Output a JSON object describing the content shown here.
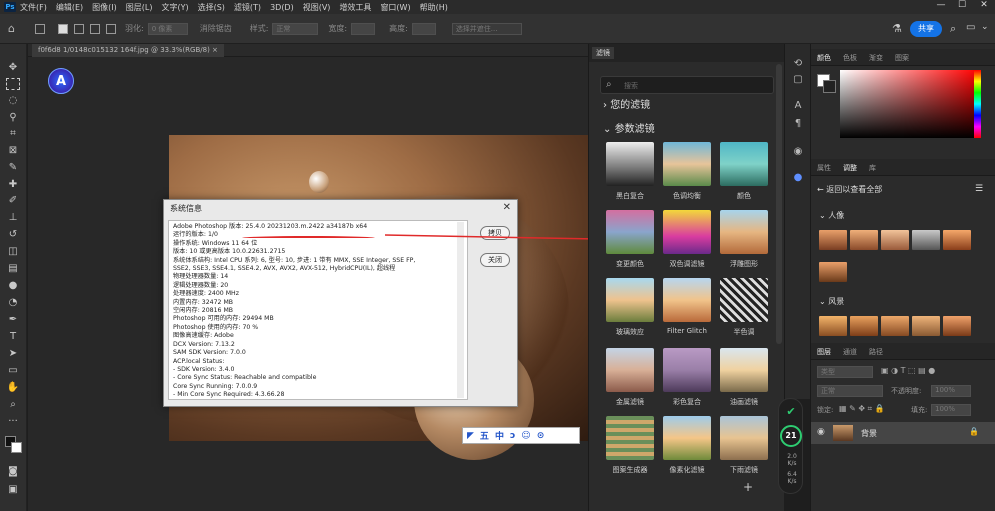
{
  "menubar": {
    "logo": "Ps",
    "items": [
      "文件(F)",
      "编辑(E)",
      "图像(I)",
      "图层(L)",
      "文字(Y)",
      "选择(S)",
      "滤镜(T)",
      "3D(D)",
      "视图(V)",
      "增效工具",
      "窗口(W)",
      "帮助(H)"
    ],
    "win_min": "—",
    "win_max": "☐",
    "win_close": "✕"
  },
  "optbar": {
    "feather_label": "羽化:",
    "feather_value": "0 像素",
    "antialias_label": "消除锯齿",
    "style_label": "样式:",
    "style_value": "正常",
    "width_label": "宽度:",
    "height_label": "高度:",
    "select_mask_label": "选择并遮住...",
    "share_label": "共享"
  },
  "doctab": {
    "label": "f0f6d8 1/0148c015132 164f.jpg @ 33.3%(RGB/8)  ×"
  },
  "app_logo": "A",
  "about": {
    "title": "系统信息",
    "close": "✕",
    "copy_label": "拷贝",
    "close_label": "关闭",
    "lines": [
      "Adobe Photoshop 版本: 25.4.0 20231203.m.2422 a34187b  x64",
      "运行的版本: 1/0",
      "操作系统: Windows 11 64 位",
      "版本: 10 或更高版本 10.0.22631.2715",
      "系统体系结构: Intel CPU 系列: 6, 型号: 10, 步进: 1 带有 MMX, SSE Integer, SSE FP,",
      "SSE2, SSE3, SSE4.1, SSE4.2, AVX, AVX2, AVX-512, HybridCPU(IL), 超线程",
      "物理处理器数量: 14",
      "逻辑处理器数量: 20",
      "处理器速度: 2400 MHz",
      "内置内存: 32472 MB",
      "空闲内存: 20816 MB",
      "Photoshop 可用的内存: 29494 MB",
      "Photoshop 使用的内存: 70 %",
      "图像高速缓存: Adobe",
      "DCX Version: 7.13.2",
      "SAM SDK Version: 7.0.0",
      "ACP.local Status:",
      " - SDK Version: 3.4.0",
      " - Core Sync Status: Reachable and compatible",
      "   Core Sync Running: 7.0.0.9",
      " - Min Core Sync Required: 4.3.66.28"
    ]
  },
  "ime": {
    "items": [
      "五",
      "中",
      "ↄ",
      "☺",
      "⊙"
    ]
  },
  "neural_filters": {
    "tab_label": "滤镜",
    "search_placeholder": "搜索",
    "section_mine": "您的滤镜",
    "section_param": "参数滤镜",
    "filters": [
      {
        "label": "黑白复合"
      },
      {
        "label": "色调均衡"
      },
      {
        "label": "颜色"
      },
      {
        "label": "变更颜色"
      },
      {
        "label": "双色调滤镜"
      },
      {
        "label": "浮雕图形"
      },
      {
        "label": "玻璃效应"
      },
      {
        "label": "Filter Glitch"
      },
      {
        "label": "半色调"
      },
      {
        "label": "金属滤镜"
      },
      {
        "label": "彩色复合"
      },
      {
        "label": "油画滤镜"
      },
      {
        "label": "图案生成器"
      },
      {
        "label": "像素化滤镜"
      },
      {
        "label": "下雨滤镜"
      }
    ],
    "add_label": "+"
  },
  "network_widget": {
    "shield": "✔",
    "value": "21",
    "up": "2.0",
    "up_unit": "K/s",
    "down": "6.4",
    "down_unit": "K/s"
  },
  "right": {
    "color_tabs": [
      "颜色",
      "色板",
      "渐变",
      "图案"
    ],
    "adj_tabs": [
      "属性",
      "调整",
      "库"
    ],
    "back_label": "返回以查看全部",
    "group_people": "人像",
    "group_landscape": "风景",
    "layer_tabs": [
      "图层",
      "通道",
      "路径"
    ],
    "kind_label": "类型",
    "blend_label": "正常",
    "opacity_label": "不透明度:",
    "opacity_value": "100%",
    "lock_label": "锁定:",
    "fill_label": "填充:",
    "fill_value": "100%",
    "layer_name": "背景"
  },
  "colors": {
    "accent": "#1473e6",
    "status_green": "#2ecc71",
    "annotation_red": "#e02a2a"
  }
}
